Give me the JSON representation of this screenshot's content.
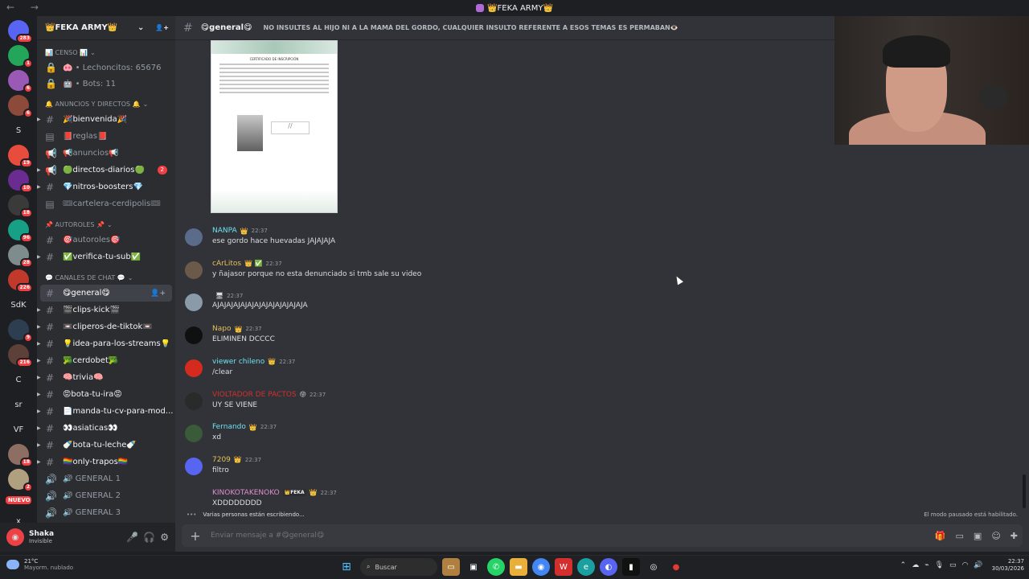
{
  "titlebar": {
    "title": "👑FEKA ARMY👑",
    "nav": "← →"
  },
  "guilds": [
    {
      "label": "",
      "color": "#5865f2",
      "badge": "283",
      "txt": false
    },
    {
      "label": "",
      "color": "#23a55a",
      "badge": "1",
      "txt": false
    },
    {
      "label": "",
      "color": "#9b59b6",
      "badge": "6",
      "txt": false
    },
    {
      "label": "",
      "color": "#8b4a3a",
      "badge": "6",
      "txt": false
    },
    {
      "label": "S",
      "color": "transparent",
      "badge": "",
      "txt": true
    },
    {
      "label": "",
      "color": "#e74c3c",
      "badge": "19",
      "txt": false
    },
    {
      "label": "",
      "color": "#6a2c91",
      "badge": "10",
      "txt": false
    },
    {
      "label": "",
      "color": "#3a3a3a",
      "badge": "18",
      "txt": false
    },
    {
      "label": "",
      "color": "#16a085",
      "badge": "96",
      "txt": false
    },
    {
      "label": "",
      "color": "#7f8c8d",
      "badge": "28",
      "txt": false
    },
    {
      "label": "",
      "color": "#c0392b",
      "badge": "226",
      "txt": false
    },
    {
      "label": "SdK",
      "color": "transparent",
      "badge": "",
      "txt": true
    },
    {
      "label": "",
      "color": "#2c3e50",
      "badge": "9",
      "txt": false
    },
    {
      "label": "",
      "color": "#5d4037",
      "badge": "216",
      "txt": false
    },
    {
      "label": "C",
      "color": "transparent",
      "badge": "",
      "txt": true
    },
    {
      "label": "sr",
      "color": "transparent",
      "badge": "",
      "txt": true
    },
    {
      "label": "VF",
      "color": "transparent",
      "badge": "",
      "txt": true
    },
    {
      "label": "",
      "color": "#8d6e63",
      "badge": "18",
      "txt": false
    },
    {
      "label": "",
      "color": "#b0a080",
      "badge": "2",
      "txt": false
    },
    {
      "label": "x",
      "color": "transparent",
      "badge": "",
      "txt": true
    }
  ],
  "nuevo": "NUEVO",
  "server": {
    "name": "👑FEKA ARMY👑",
    "chevron": "⌄",
    "invite_icon": "👤+"
  },
  "channel_rows": [
    {
      "kind": "cat",
      "text": "📊 CENSO 📊"
    },
    {
      "kind": "info",
      "icon": "🔒",
      "text": "🐽 • Lechoncitos: 65676"
    },
    {
      "kind": "info",
      "icon": "🔒",
      "text": "🤖 • Bots: 11"
    },
    {
      "kind": "cat",
      "text": "🔔 ANUNCIOS Y DIRECTOS 🔔"
    },
    {
      "kind": "ch",
      "icon": "#",
      "text": "🎉bienvenida🎉",
      "arrow": true,
      "white": true
    },
    {
      "kind": "ch",
      "icon": "▤",
      "text": "📕reglas📕",
      "arrow": false,
      "white": false
    },
    {
      "kind": "ch",
      "icon": "📢",
      "text": "📢anuncios📢",
      "arrow": false,
      "white": false
    },
    {
      "kind": "ch",
      "icon": "📢",
      "text": "🟢directos-diarios🟢",
      "arrow": true,
      "white": true,
      "badge": "2"
    },
    {
      "kind": "ch",
      "icon": "#",
      "text": "💎nitros-boosters💎",
      "arrow": true,
      "white": true
    },
    {
      "kind": "ch",
      "icon": "▤",
      "text": "🎟cartelera-cerdipolis🎟",
      "arrow": false,
      "white": false
    },
    {
      "kind": "cat",
      "text": "📌 AUTOROLES 📌"
    },
    {
      "kind": "ch",
      "icon": "#",
      "text": "🎯autoroles🎯",
      "arrow": false,
      "white": false
    },
    {
      "kind": "ch",
      "icon": "#",
      "text": "✅verifica-tu-sub✅",
      "arrow": true,
      "white": true
    },
    {
      "kind": "cat",
      "text": "💬 CANALES DE CHAT 💬"
    },
    {
      "kind": "ch",
      "icon": "#",
      "text": "😋general😋",
      "arrow": false,
      "white": true,
      "active": true,
      "act": "👤+"
    },
    {
      "kind": "ch",
      "icon": "#",
      "text": "🎬clips-kick🎬",
      "arrow": true,
      "white": true
    },
    {
      "kind": "ch",
      "icon": "#",
      "text": "📼cliperos-de-tiktok📼",
      "arrow": true,
      "white": true
    },
    {
      "kind": "ch",
      "icon": "#",
      "text": "💡idea-para-los-streams💡",
      "arrow": true,
      "white": true
    },
    {
      "kind": "ch",
      "icon": "#",
      "text": "🥦cerdobet🥦",
      "arrow": true,
      "white": true
    },
    {
      "kind": "ch",
      "icon": "#",
      "text": "🧠trivia🧠",
      "arrow": true,
      "white": true
    },
    {
      "kind": "ch",
      "icon": "#",
      "text": "😡bota-tu-ira😡",
      "arrow": true,
      "white": true
    },
    {
      "kind": "ch",
      "icon": "#",
      "text": "📄manda-tu-cv-para-mod...",
      "arrow": true,
      "white": true
    },
    {
      "kind": "ch",
      "icon": "#",
      "text": "👀asiaticas👀",
      "arrow": true,
      "white": true
    },
    {
      "kind": "ch",
      "icon": "#",
      "text": "🍼bota-tu-leche🍼",
      "arrow": true,
      "white": true
    },
    {
      "kind": "ch",
      "icon": "#",
      "text": "🏳️‍🌈only-trapos🏳️‍🌈",
      "arrow": true,
      "white": true
    },
    {
      "kind": "ch",
      "icon": "🔊",
      "text": "🔊 GENERAL 1",
      "arrow": false,
      "white": false
    },
    {
      "kind": "ch",
      "icon": "🔊",
      "text": "🔊 GENERAL 2",
      "arrow": false,
      "white": false
    },
    {
      "kind": "ch",
      "icon": "🔊",
      "text": "🔊 GENERAL 3",
      "arrow": false,
      "white": false
    }
  ],
  "user": {
    "name": "Shaka",
    "status": "Invisible",
    "mic_icon": "🎤",
    "head_icon": "🎧",
    "gear_icon": "⚙"
  },
  "chat": {
    "channel": "😋general😋",
    "topic": "NO INSULTES AL HIJO NI A LA MAMÁ DEL GORDO, CUALQUIER INSULTO REFERENTE A ESOS TEMAS ES PERMABAN👁️",
    "certificate_title": "CERTIFICADO DE INSCRIPCIÓN",
    "messages": [
      {
        "author": "NANPA",
        "icon": "👑",
        "time": "22:37",
        "text": "ese gordo hace huevadas JAJAJAJA",
        "color": "#6ee0f0",
        "avatar": "#5a6c8a",
        "tag": ""
      },
      {
        "author": "cArLitos",
        "icon": "👑 ✅",
        "time": "22:37",
        "text": "y ñajasor porque no esta denunciado si tmb sale su video",
        "color": "#e4c05a",
        "avatar": "#6b5a4a",
        "tag": ""
      },
      {
        "author": "",
        "icon": "🖥",
        "time": "22:37",
        "text": "AJAJAJAJAJAJAJAJAJAJAJAJAJA",
        "color": "#7b55c9",
        "avatar": "#8a9aa8",
        "tag": ""
      },
      {
        "author": "Napo",
        "icon": "👑",
        "time": "22:37",
        "text": "ELIMINEN DCCCC",
        "color": "#e4c05a",
        "avatar": "#101010",
        "tag": ""
      },
      {
        "author": "viewer chileno",
        "icon": "👑",
        "time": "22:37",
        "text": "/clear",
        "color": "#6ee0f0",
        "avatar": "#d52b1e",
        "tag": ""
      },
      {
        "author": "VIOLTADOR DE PACTOS",
        "icon": "😝",
        "time": "22:37",
        "text": "UY SE VIENE",
        "color": "#d32f2f",
        "avatar": "#2a2a2a",
        "tag": ""
      },
      {
        "author": "Fernando",
        "icon": "👑",
        "time": "22:37",
        "text": "xd",
        "color": "#6ee0f0",
        "avatar": "#3b5a3a",
        "tag": ""
      },
      {
        "author": "7209",
        "icon": "👑",
        "time": "22:37",
        "text": "filtro",
        "color": "#e4c05a",
        "avatar": "#5865f2",
        "tag": ""
      },
      {
        "author": "KINOKOTAKENOKO",
        "icon": "👑",
        "time": "22:37",
        "text": "XDDDDDDDD",
        "color": "#e08fd0",
        "avatar": "#313338",
        "tag": "👑FEKA"
      }
    ],
    "typing": "Varias personas están escribiendo...",
    "paused": "El modo pausado está habilitado.",
    "composer_placeholder": "Enviar mensaje a #😋general😋"
  },
  "taskbar": {
    "temp": "21°C",
    "weather": "Mayorm. nublado",
    "search": "Buscar",
    "time": "22:37",
    "date": "30/03/2026"
  }
}
